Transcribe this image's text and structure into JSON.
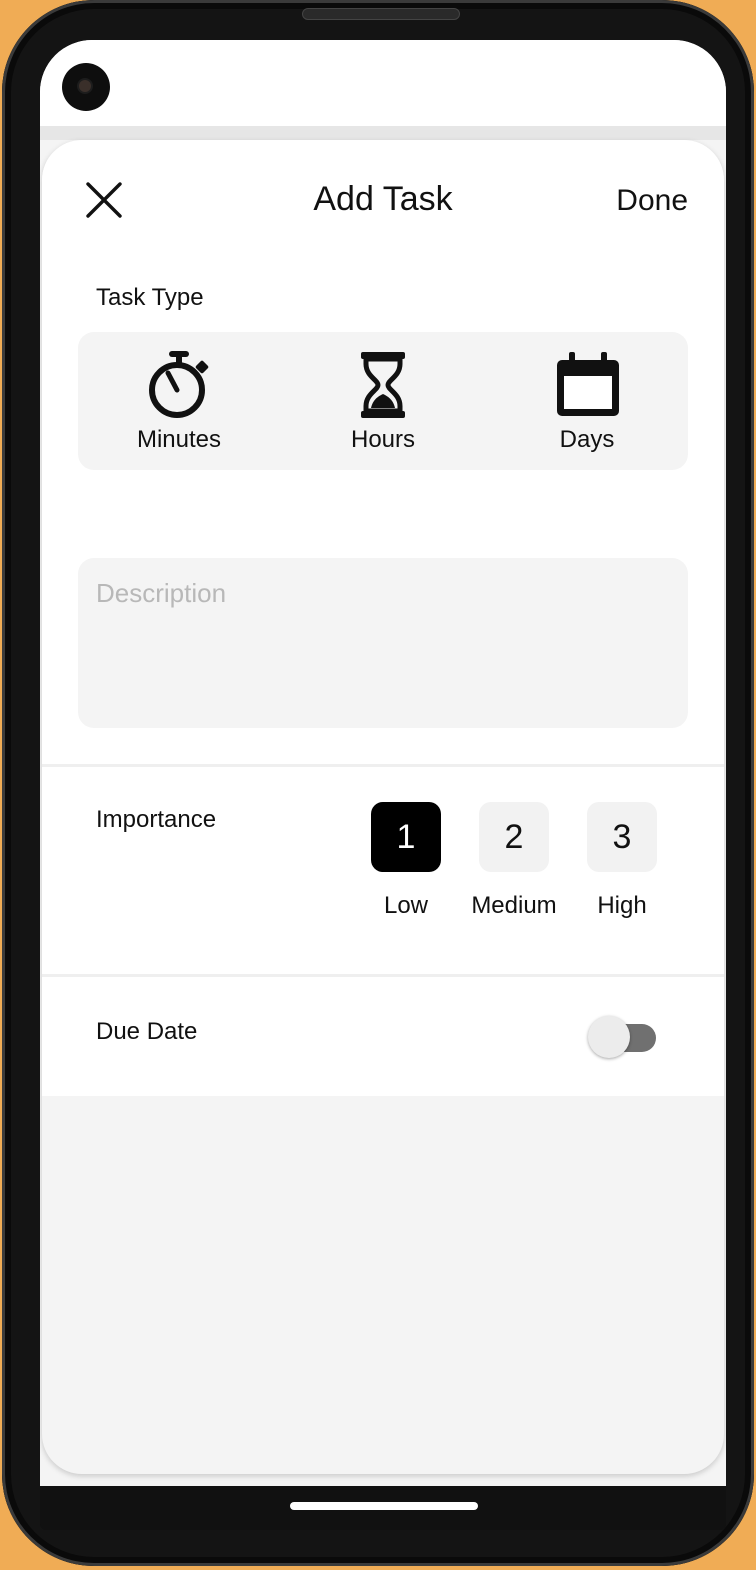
{
  "header": {
    "title": "Add Task",
    "done_label": "Done",
    "close_icon": "close-icon"
  },
  "task_type": {
    "label": "Task Type",
    "options": [
      {
        "label": "Minutes",
        "icon": "stopwatch-icon"
      },
      {
        "label": "Hours",
        "icon": "hourglass-icon"
      },
      {
        "label": "Days",
        "icon": "calendar-icon"
      }
    ]
  },
  "description": {
    "placeholder": "Description",
    "value": ""
  },
  "importance": {
    "label": "Importance",
    "selected": "1",
    "options": [
      {
        "value": "1",
        "label": "Low"
      },
      {
        "value": "2",
        "label": "Medium"
      },
      {
        "value": "3",
        "label": "High"
      }
    ]
  },
  "due_date": {
    "label": "Due Date",
    "enabled": false
  },
  "colors": {
    "frame_background": "#f0ac55",
    "selected_button": "#000000",
    "field_background": "#f4f4f4",
    "toggle_track": "#707070"
  }
}
